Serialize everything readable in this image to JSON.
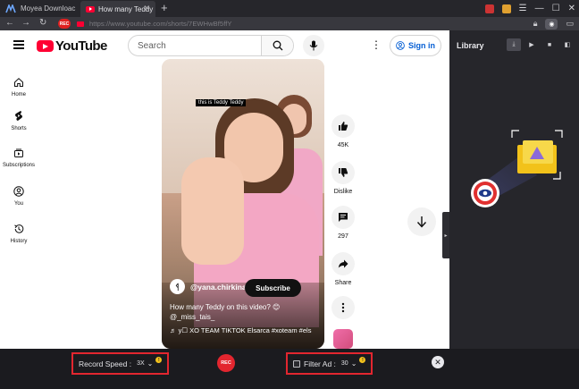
{
  "browser": {
    "app_tab": "Moyea Downloac",
    "active_tab": "How many Teddy",
    "new_tab_glyph": "+",
    "url": "https://www.youtube.com/shorts/7EWHwBf5ffY",
    "rec_badge": "REC",
    "icons": [
      "back-arrow-icon",
      "forward-arrow-icon",
      "reload-icon",
      "lock-icon",
      "camera-icon"
    ]
  },
  "youtube": {
    "logo_text": "YouTube",
    "search_placeholder": "Search",
    "sign_in": "Sign in",
    "sidebar": [
      {
        "label": "Home",
        "icon": "home-icon"
      },
      {
        "label": "Shorts",
        "icon": "shorts-icon"
      },
      {
        "label": "Subscriptions",
        "icon": "subscriptions-icon"
      },
      {
        "label": "You",
        "icon": "user-icon"
      },
      {
        "label": "History",
        "icon": "history-icon"
      }
    ],
    "video": {
      "caption": "this is Teddy Teddy",
      "channel_initial": "ᛩ",
      "channel": "@yana.chirkina",
      "subscribe": "Subscribe",
      "title": "How many Teddy on this video? 😊 @_miss_tais_",
      "music": "♬ y☐ XO TEAM TIKTOK Elsarca #xoteam #els"
    },
    "actions": {
      "likes": "45K",
      "dislike": "Dislike",
      "comments": "297",
      "share": "Share"
    }
  },
  "library": {
    "title": "Library",
    "tools": [
      "download-icon",
      "youtube-icon",
      "video-icon",
      "panel-icon"
    ]
  },
  "recorder": {
    "record_speed_label": "Record Speed :",
    "record_speed_value": "3X",
    "rec_button": "REC",
    "filter_ad_label": "Filter Ad :",
    "filter_ad_value": "30",
    "info_glyph": "!",
    "close_glyph": "✕"
  },
  "colors": {
    "youtube_red": "#ff0033",
    "rec_red": "#e3262f",
    "link_blue": "#065fd4",
    "panel_dark": "#26262b"
  }
}
